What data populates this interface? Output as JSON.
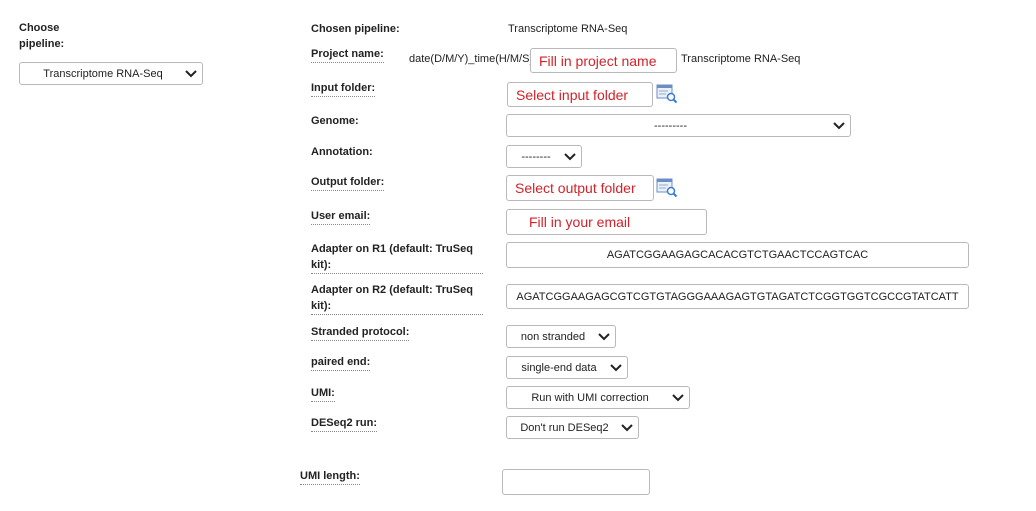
{
  "sidebar": {
    "choose_label": "Choose pipeline:",
    "pipeline_value": "Transcriptome RNA-Seq"
  },
  "form": {
    "chosen_label": "Chosen pipeline:",
    "chosen_value": "Transcriptome RNA-Seq",
    "project_label": "Project name:",
    "project_prefix": "date(D/M/Y)_time(H/M/S)",
    "project_placeholder": "Fill in project name",
    "project_suffix": "Transcriptome RNA-Seq",
    "input_label": "Input folder:",
    "input_placeholder": "Select input folder",
    "genome_label": "Genome:",
    "genome_value": "---------",
    "annotation_label": "Annotation:",
    "annotation_value": "--------",
    "output_label": "Output folder:",
    "output_placeholder": "Select output folder",
    "email_label": "User email:",
    "email_placeholder": "Fill in your email",
    "r1_label_line1": "Adapter on R1 (default: TruSeq",
    "r1_label_line2": "kit):",
    "r1_value": "AGATCGGAAGAGCACACGTCTGAACTCCAGTCAC",
    "r2_label_line1": "Adapter on R2 (default: TruSeq",
    "r2_label_line2": "kit):",
    "r2_value": "AGATCGGAAGAGCGTCGTGTAGGGAAAGAGTGTAGATCTCGGTGGTCGCCGTATCATT",
    "stranded_label": "Stranded protocol:",
    "stranded_value": "non stranded",
    "paired_label": "paired end:",
    "paired_value": "single-end data",
    "umi_label": "UMI:",
    "umi_value": "Run with UMI correction",
    "deseq_label": "DESeq2 run:",
    "deseq_value": "Don't run DESeq2",
    "umi_length_label": "UMI length:",
    "umi_length_value": ""
  },
  "colors": {
    "placeholder_red": "#d2232a",
    "border": "#b9b9b9",
    "browse_icon_blue": "#3a7bd5"
  }
}
